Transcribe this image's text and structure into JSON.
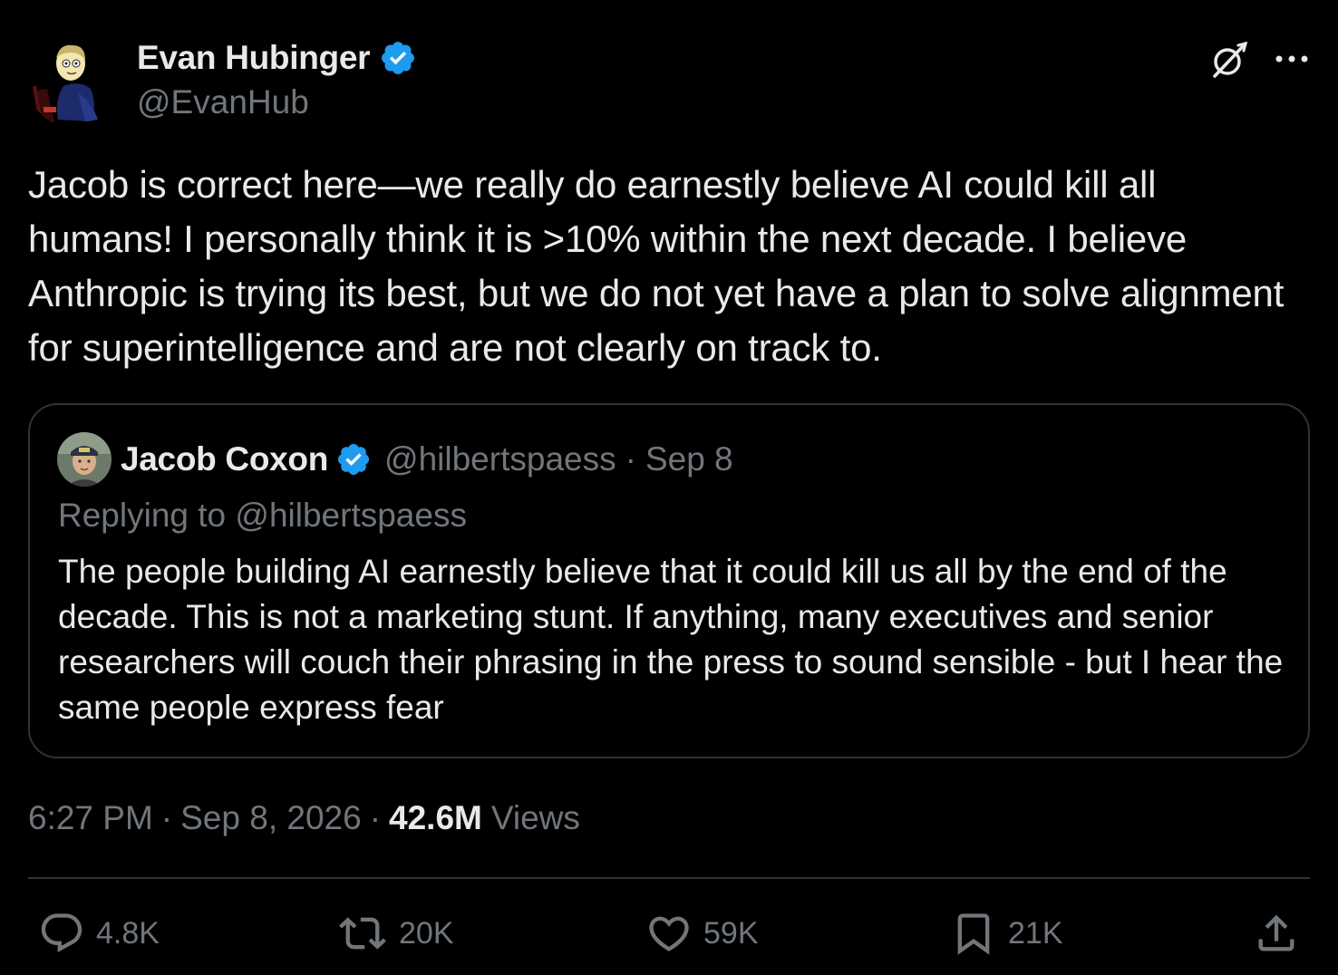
{
  "author": {
    "name": "Evan Hubinger",
    "handle": "@EvanHub",
    "verified": true,
    "avatar": "cartoon-avatar"
  },
  "header_icons": {
    "grok": "grok-icon",
    "more": "more-icon"
  },
  "tweet": {
    "text": "Jacob is correct here—we really do earnestly believe AI could kill all humans! I personally think it is >10% within the next decade. I believe Anthropic is trying its best, but we do not yet have a plan to solve alignment for superintelligence and are not clearly on track to."
  },
  "quote": {
    "name": "Jacob Coxon",
    "handle": "@hilbertspaess",
    "separator": "·",
    "date": "Sep 8",
    "replying_to": "Replying to @hilbertspaess",
    "text": "The people building AI earnestly believe that it could kill us all by the end of the decade. This is not a marketing stunt. If anything, many executives and senior researchers will couch their phrasing in the press to sound sensible - but I hear the same people express fear"
  },
  "meta": {
    "time": "6:27 PM",
    "sep1": "·",
    "date": "Sep 8, 2026",
    "sep2": "·",
    "views_count": "42.6M",
    "views_label": "Views"
  },
  "actions": {
    "replies": "4.8K",
    "reposts": "20K",
    "likes": "59K",
    "bookmarks": "21K"
  },
  "colors": {
    "background": "#000000",
    "text": "#e7e9ea",
    "secondary": "#71767b",
    "border": "#2f3336",
    "verified": "#1d9bf0"
  }
}
